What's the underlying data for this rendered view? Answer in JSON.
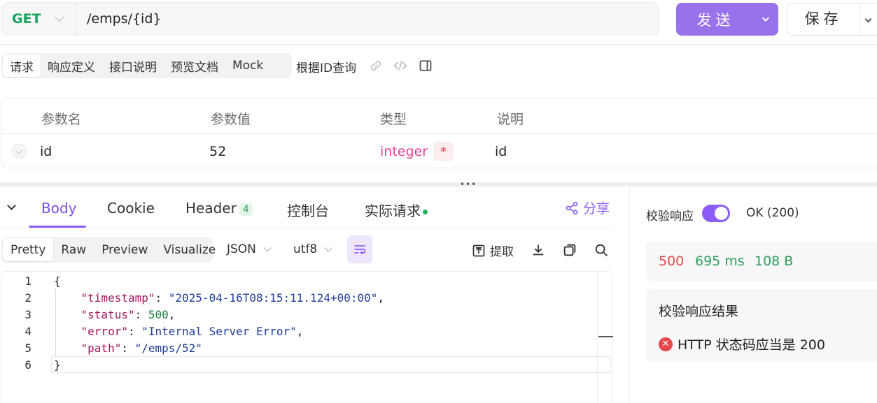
{
  "request": {
    "method": "GET",
    "url": "/emps/{id}",
    "send_label": "发送",
    "save_label": "保存"
  },
  "tabs": [
    {
      "label": "请求",
      "active": true
    },
    {
      "label": "响应定义"
    },
    {
      "label": "接口说明"
    },
    {
      "label": "预览文档"
    },
    {
      "label": "Mock"
    }
  ],
  "api_name": "根据ID查询",
  "params": {
    "headers": [
      "参数名",
      "参数值",
      "类型",
      "说明"
    ],
    "row": {
      "name": "id",
      "value": "52",
      "type": "integer",
      "required_mark": "*",
      "description": "id"
    }
  },
  "response_tabs": {
    "body": "Body",
    "cookie": "Cookie",
    "header": "Header",
    "header_count": "4",
    "console": "控制台",
    "actual_request": "实际请求",
    "share": "分享"
  },
  "view_modes": [
    {
      "label": "Pretty",
      "active": true
    },
    {
      "label": "Raw"
    },
    {
      "label": "Preview"
    },
    {
      "label": "Visualize"
    }
  ],
  "format": "JSON",
  "encoding": "utf8",
  "extract_label": "提取",
  "code": {
    "line_numbers": [
      "1",
      "2",
      "3",
      "4",
      "5",
      "6"
    ],
    "open_brace": "{",
    "close_brace": "}",
    "fields": [
      {
        "key": "\"timestamp\"",
        "value": "\"2025-04-16T08:15:11.124+00:00\"",
        "kind": "string"
      },
      {
        "key": "\"status\"",
        "value": "500",
        "kind": "number"
      },
      {
        "key": "\"error\"",
        "value": "\"Internal Server Error\"",
        "kind": "string"
      },
      {
        "key": "\"path\"",
        "value": "\"/emps/52\"",
        "kind": "string"
      }
    ]
  },
  "verify": {
    "label": "校验响应",
    "enabled": true,
    "ok_text": "OK (200)",
    "status_code": "500",
    "time": "695 ms",
    "size": "108 B",
    "result_title": "校验响应结果",
    "result_item": "HTTP 状态码应当是 200"
  },
  "colors": {
    "accent": "#8b5cf6",
    "method_green": "#19a35c",
    "error_red": "#e5484d",
    "success_green": "#2f9e5b",
    "type_pink": "#e83e9c"
  }
}
